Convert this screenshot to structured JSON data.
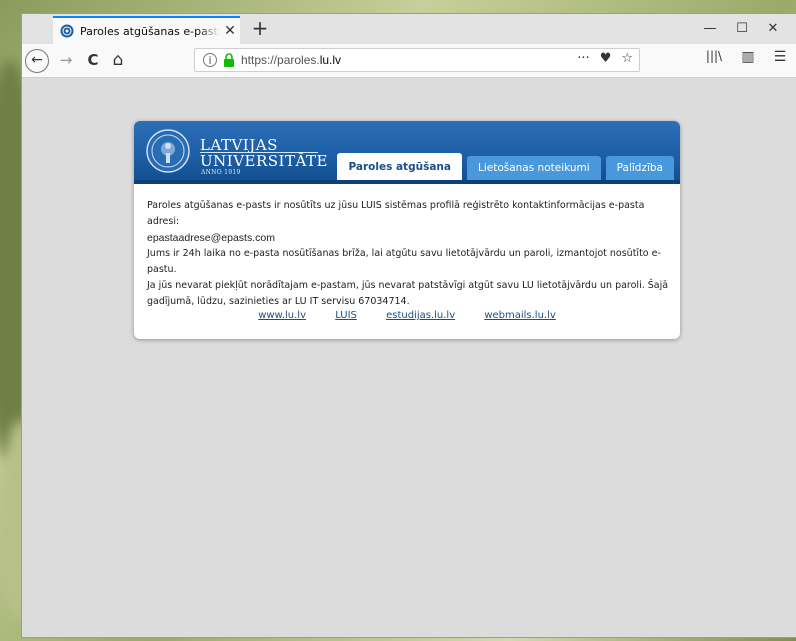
{
  "browser": {
    "tab_title": "Paroles atgūšanas e-pasts nosūtīts",
    "tab_close": "✕",
    "new_tab": "+",
    "url_host_prefix": "https://paroles.",
    "url_host_domain": "lu.lv",
    "window_minimize": "—",
    "window_maximize": "☐",
    "window_close": "✕",
    "toolbar": {
      "back": "←",
      "forward": "→",
      "reload": "C",
      "home": "⌂",
      "more": "···",
      "pocket": "♥",
      "bookmark": "☆",
      "library": "|||\\",
      "sidebar": "▥",
      "menu": "☰"
    },
    "accent_color": "#0a84ff"
  },
  "page": {
    "logo": {
      "line1": "LATVIJAS",
      "line2": "UNIVERSITĀTE",
      "anno": "ANNO 1919"
    },
    "tabs": [
      {
        "label": "Paroles atgūšana",
        "active": true
      },
      {
        "label": "Lietošanas noteikumi",
        "active": false
      },
      {
        "label": "Palīdzība",
        "active": false
      }
    ],
    "message": {
      "line1": "Paroles atgūšanas e-pasts ir nosūtīts uz jūsu LUIS sistēmas profilā reģistrēto kontaktinformācijas e-pasta adresi:",
      "email": "epastaadrese@epasts.com",
      "line3": "Jums ir 24h laika no e-pasta nosūtīšanas brīža, lai atgūtu savu lietotājvārdu un paroli, izmantojot nosūtīto e-pastu.",
      "line4": "Ja jūs nevarat piekļūt norādītajam e-pastam, jūs nevarat patstāvīgi atgūt savu LU lietotājvārdu un paroli. Šajā gadījumā, lūdzu, sazinieties ar LU IT servisu 67034714."
    },
    "links": [
      "www.lu.lv",
      "LUIS",
      "estudijas.lu.lv",
      "webmails.lu.lv"
    ],
    "header_color": "#1d5ea6"
  }
}
